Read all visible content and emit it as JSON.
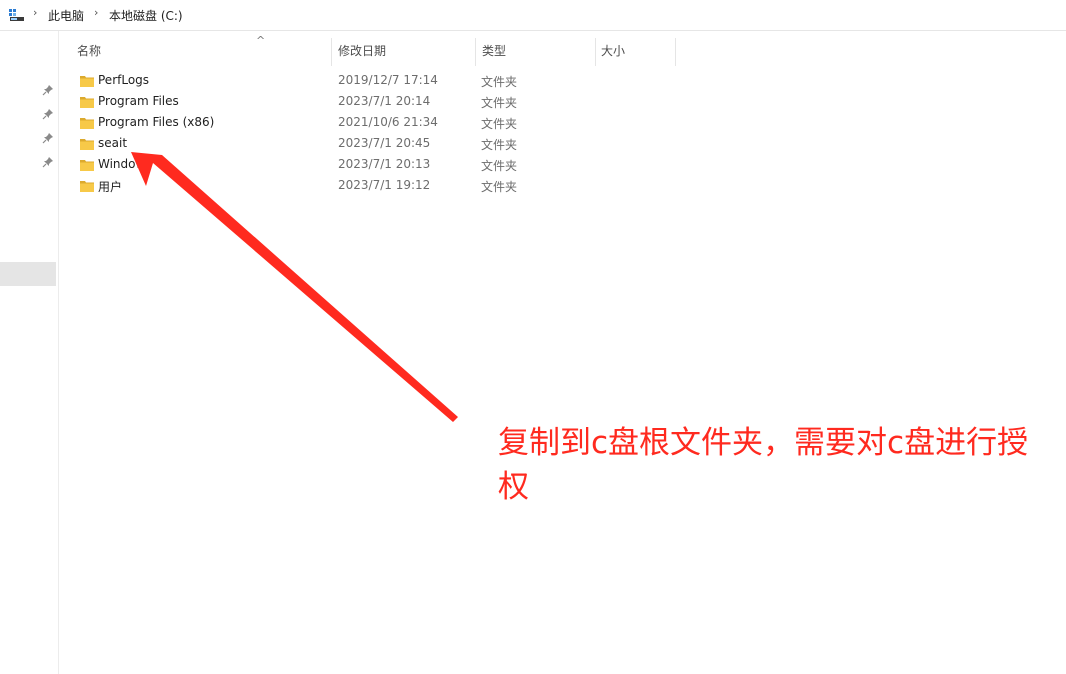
{
  "address_bar": {
    "crumbs": [
      "此电脑",
      "本地磁盘 (C:)"
    ]
  },
  "columns": {
    "name": "名称",
    "modified": "修改日期",
    "type": "类型",
    "size": "大小"
  },
  "files": [
    {
      "name": "PerfLogs",
      "modified": "2019/12/7 17:14",
      "type": "文件夹"
    },
    {
      "name": "Program Files",
      "modified": "2023/7/1 20:14",
      "type": "文件夹"
    },
    {
      "name": "Program Files (x86)",
      "modified": "2021/10/6 21:34",
      "type": "文件夹"
    },
    {
      "name": "seait",
      "modified": "2023/7/1 20:45",
      "type": "文件夹"
    },
    {
      "name": "Windows",
      "modified": "2023/7/1 20:13",
      "type": "文件夹"
    },
    {
      "name": "用户",
      "modified": "2023/7/1 19:12",
      "type": "文件夹"
    }
  ],
  "annotation": {
    "text": "复制到c盘根文件夹，需要对c盘进行授权",
    "color": "#ff2a1f"
  },
  "colors": {
    "folder": "#f7c948",
    "selection": "#e5e5e5"
  }
}
